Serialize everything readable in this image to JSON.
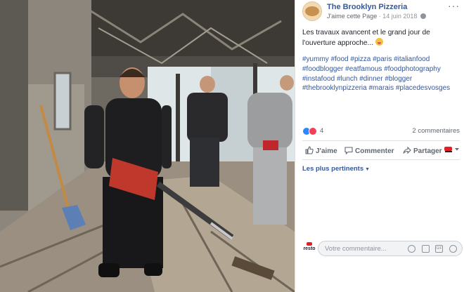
{
  "post": {
    "page_name": "The Brooklyn Pizzeria",
    "like_page": "J'aime cette Page",
    "separator": "·",
    "date": "14 juin 2018",
    "privacy_icon": "globe-icon",
    "more_icon": "more-options-icon",
    "text": "Les travaux avancent et le grand jour de l'ouverture approche...",
    "hashtags": [
      "#yummy",
      "#food",
      "#pizza",
      "#paris",
      "#italianfood",
      "#foodblogger",
      "#eatfamous",
      "#foodphotography",
      "#instafood",
      "#lunch",
      "#dinner",
      "#blogger",
      "#thebrooklynpizzeria",
      "#marais",
      "#placedesvosges"
    ]
  },
  "stats": {
    "reaction_count": "4",
    "comments": "2 commentaires"
  },
  "actions": {
    "like": "J'aime",
    "comment": "Commenter",
    "share": "Partager"
  },
  "filter": {
    "label": "Les plus pertinents"
  },
  "comment_box": {
    "logo_text": "resto",
    "placeholder": "Votre commentaire..."
  },
  "colors": {
    "link": "#365899",
    "text": "#1d2129",
    "meta": "#90949c",
    "like_reaction": "#2d88ff",
    "love_reaction": "#f33e58"
  }
}
